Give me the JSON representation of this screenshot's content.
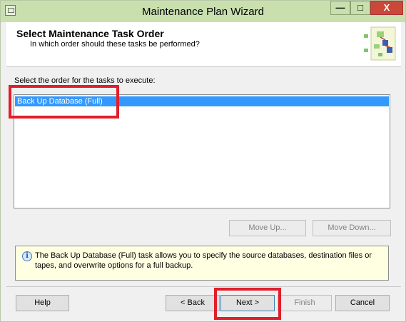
{
  "window": {
    "title": "Maintenance Plan Wizard",
    "minimize_label": "—",
    "maximize_label": "□",
    "close_label": "X"
  },
  "header": {
    "title": "Select Maintenance Task Order",
    "subtitle": "In which order should these tasks be performed?"
  },
  "list": {
    "label": "Select the order for the tasks to execute:",
    "items": [
      "Back Up Database (Full)"
    ],
    "selected": "Back Up Database (Full)"
  },
  "order_buttons": {
    "move_up": "Move Up...",
    "move_down": "Move Down..."
  },
  "info": {
    "icon": "info-icon",
    "text": "The Back Up Database (Full) task allows you to specify the source databases, destination files or tapes, and overwrite options for a full backup."
  },
  "footer": {
    "help": "Help",
    "back": "< Back",
    "next": "Next >",
    "finish": "Finish",
    "cancel": "Cancel"
  },
  "colors": {
    "titlebar": "#c9e0ae",
    "selection": "#3399ff",
    "highlight": "#e11e2a",
    "info_background": "#ffffe1"
  }
}
